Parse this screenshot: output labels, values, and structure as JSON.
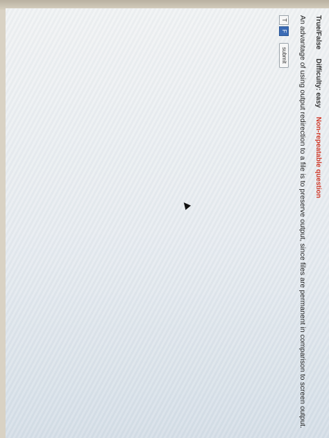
{
  "question": {
    "type": "True/False",
    "difficulty": "Difficulty: easy",
    "repeatability": "Non-repeatable question",
    "text": "An advantage of using output redirection to a file is to preserve output, since files are permanent in comparison to screen output."
  },
  "answer": {
    "true_label": "T",
    "false_label": "F",
    "selected": "F",
    "submit_label": "submit"
  },
  "colors": {
    "accent": "#3b6bb5",
    "warning": "#d03a2a"
  },
  "icons": {
    "cursor": "mouse-pointer-icon"
  }
}
